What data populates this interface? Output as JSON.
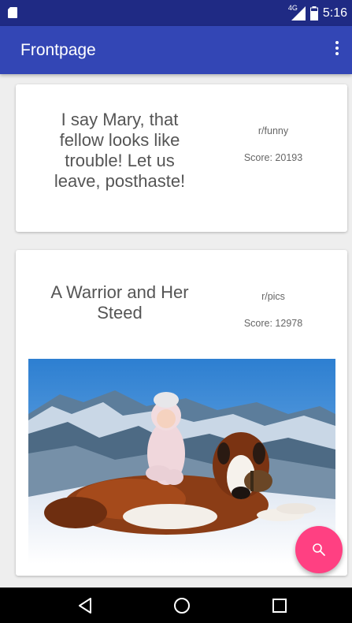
{
  "status_bar": {
    "network_label": "4G",
    "time": "5:16"
  },
  "app_bar": {
    "title": "Frontpage",
    "overflow_icon": "more-vert-icon"
  },
  "posts": [
    {
      "title": "I say Mary, that fellow looks like trouble! Let us leave, posthaste!",
      "subreddit": "r/funny",
      "score": "Score: 20193",
      "has_image": false
    },
    {
      "title": "A Warrior and Her Steed",
      "subreddit": "r/pics",
      "score": "Score: 12978",
      "has_image": true
    }
  ],
  "fab": {
    "icon": "search-icon",
    "color": "#ff4082"
  },
  "nav_bar": {
    "icons": [
      "back-icon",
      "home-icon",
      "recents-icon"
    ]
  },
  "colors": {
    "status_bar": "#1f2a84",
    "app_bar": "#3346b5",
    "background": "#eeeeee"
  }
}
